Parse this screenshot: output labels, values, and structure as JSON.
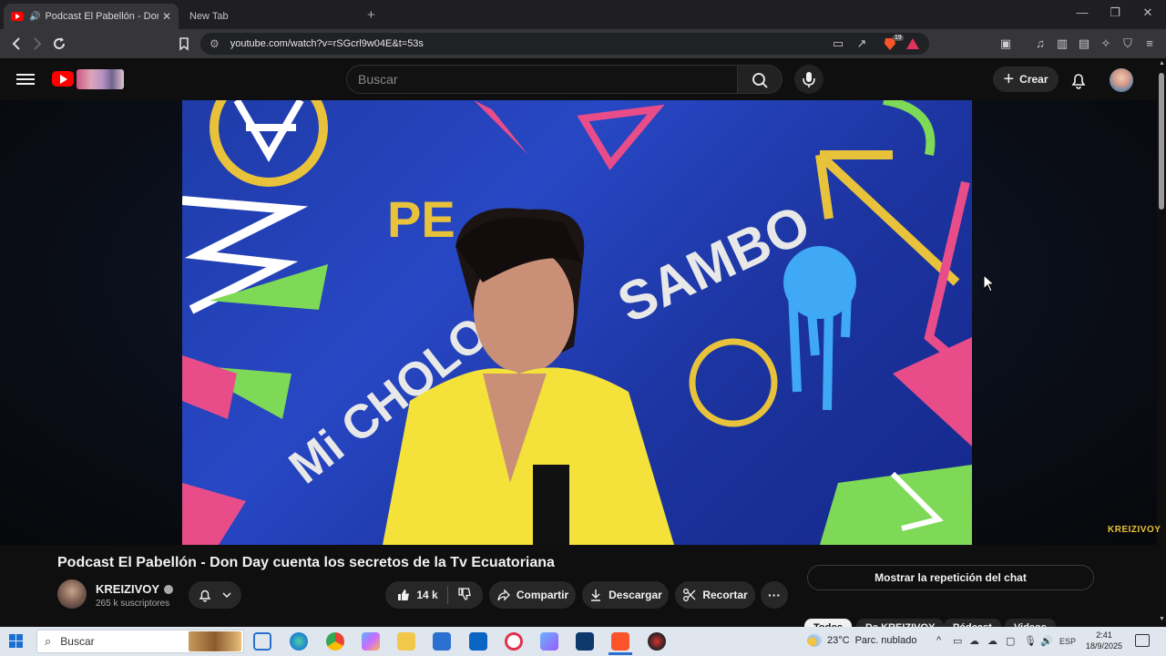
{
  "browser": {
    "tabs": [
      {
        "title": "Podcast El Pabellón - Don Day",
        "active": true
      },
      {
        "title": "New Tab",
        "active": false
      }
    ],
    "new_tab_symbol": "+",
    "url": "youtube.com/watch?v=rSGcrl9w04E&t=53s",
    "window_controls": [
      "—",
      "❐",
      "✕"
    ],
    "extension_badge": "19"
  },
  "youtube": {
    "search_placeholder": "Buscar",
    "create_label": "Crear",
    "video": {
      "title": "Podcast El Pabellón - Don Day cuenta los secretos de la Tv Ecuatoriana",
      "watermark": "KREIZIVOY",
      "frame_text": [
        "SAMBO",
        "Mi CHOLO",
        "PE"
      ]
    },
    "channel": {
      "name": "KREIZIVOY",
      "subscribers": "265 k suscriptores"
    },
    "actions": {
      "likes": "14 k",
      "share": "Compartir",
      "download": "Descargar",
      "clip": "Recortar",
      "more": "···"
    },
    "chat_replay": "Mostrar la repetición del chat",
    "chips": [
      "Todos",
      "De KREIZIVOY",
      "Pódcast",
      "Videos"
    ]
  },
  "taskbar": {
    "search_placeholder": "Buscar",
    "weather": {
      "temp": "23°C",
      "desc": "Parc. nublado"
    },
    "language": "ESP",
    "time": "2:41",
    "date": "18/9/2025"
  },
  "colors": {
    "yt_bg": "#0f0f0f",
    "yt_red": "#ff0000",
    "chip_bg": "#272727",
    "taskbar_bg": "#dfe6ee",
    "video_blue": "#2747c4"
  }
}
